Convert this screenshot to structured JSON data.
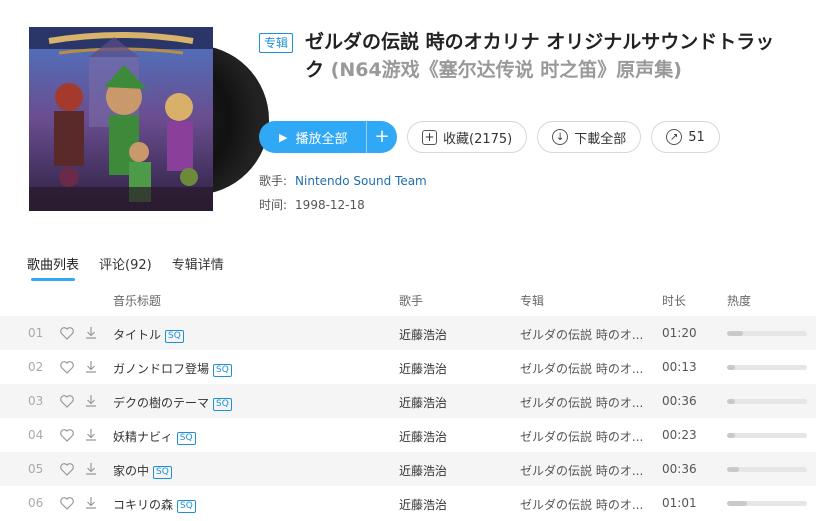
{
  "album": {
    "badge": "专辑",
    "title_main": "ゼルダの伝説 時のオカリナ オリジナルサウンドトラック",
    "title_sub": "(N64游戏《塞尔达传说 时之笛》原声集)",
    "cover_art_icon": "zelda-ocarina-cover-art"
  },
  "actions": {
    "play_all": "播放全部",
    "play_add": "+",
    "collect": "收藏(2175)",
    "download_all": "下載全部",
    "share_count": "51"
  },
  "meta": {
    "artist_label": "歌手:",
    "artist": "Nintendo Sound Team",
    "time_label": "时间:",
    "time": "1998-12-18"
  },
  "tabs": [
    {
      "label": "歌曲列表",
      "active": true
    },
    {
      "label": "评论(92)",
      "active": false
    },
    {
      "label": "专辑详情",
      "active": false
    }
  ],
  "columns": {
    "title": "音乐标题",
    "artist": "歌手",
    "album": "专辑",
    "duration": "时长",
    "heat": "热度"
  },
  "colors": {
    "accent": "#31a8f5",
    "link": "#1e6fb0",
    "sq": "#1e90d6"
  },
  "tracks": [
    {
      "num": "01",
      "title": "タイトル",
      "sq": "SQ",
      "artist": "近藤浩治",
      "album": "ゼルダの伝説 時のオ...",
      "duration": "01:20",
      "heat": 0.2
    },
    {
      "num": "02",
      "title": "ガノンドロフ登場",
      "sq": "SQ",
      "artist": "近藤浩治",
      "album": "ゼルダの伝説 時のオ...",
      "duration": "00:13",
      "heat": 0.1
    },
    {
      "num": "03",
      "title": "デクの樹のテーマ",
      "sq": "SQ",
      "artist": "近藤浩治",
      "album": "ゼルダの伝説 時のオ...",
      "duration": "00:36",
      "heat": 0.1
    },
    {
      "num": "04",
      "title": "妖精ナビィ",
      "sq": "SQ",
      "artist": "近藤浩治",
      "album": "ゼルダの伝説 時のオ...",
      "duration": "00:23",
      "heat": 0.1
    },
    {
      "num": "05",
      "title": "家の中",
      "sq": "SQ",
      "artist": "近藤浩治",
      "album": "ゼルダの伝説 時のオ...",
      "duration": "00:36",
      "heat": 0.15
    },
    {
      "num": "06",
      "title": "コキリの森",
      "sq": "SQ",
      "artist": "近藤浩治",
      "album": "ゼルダの伝説 時のオ...",
      "duration": "01:01",
      "heat": 0.25
    }
  ]
}
